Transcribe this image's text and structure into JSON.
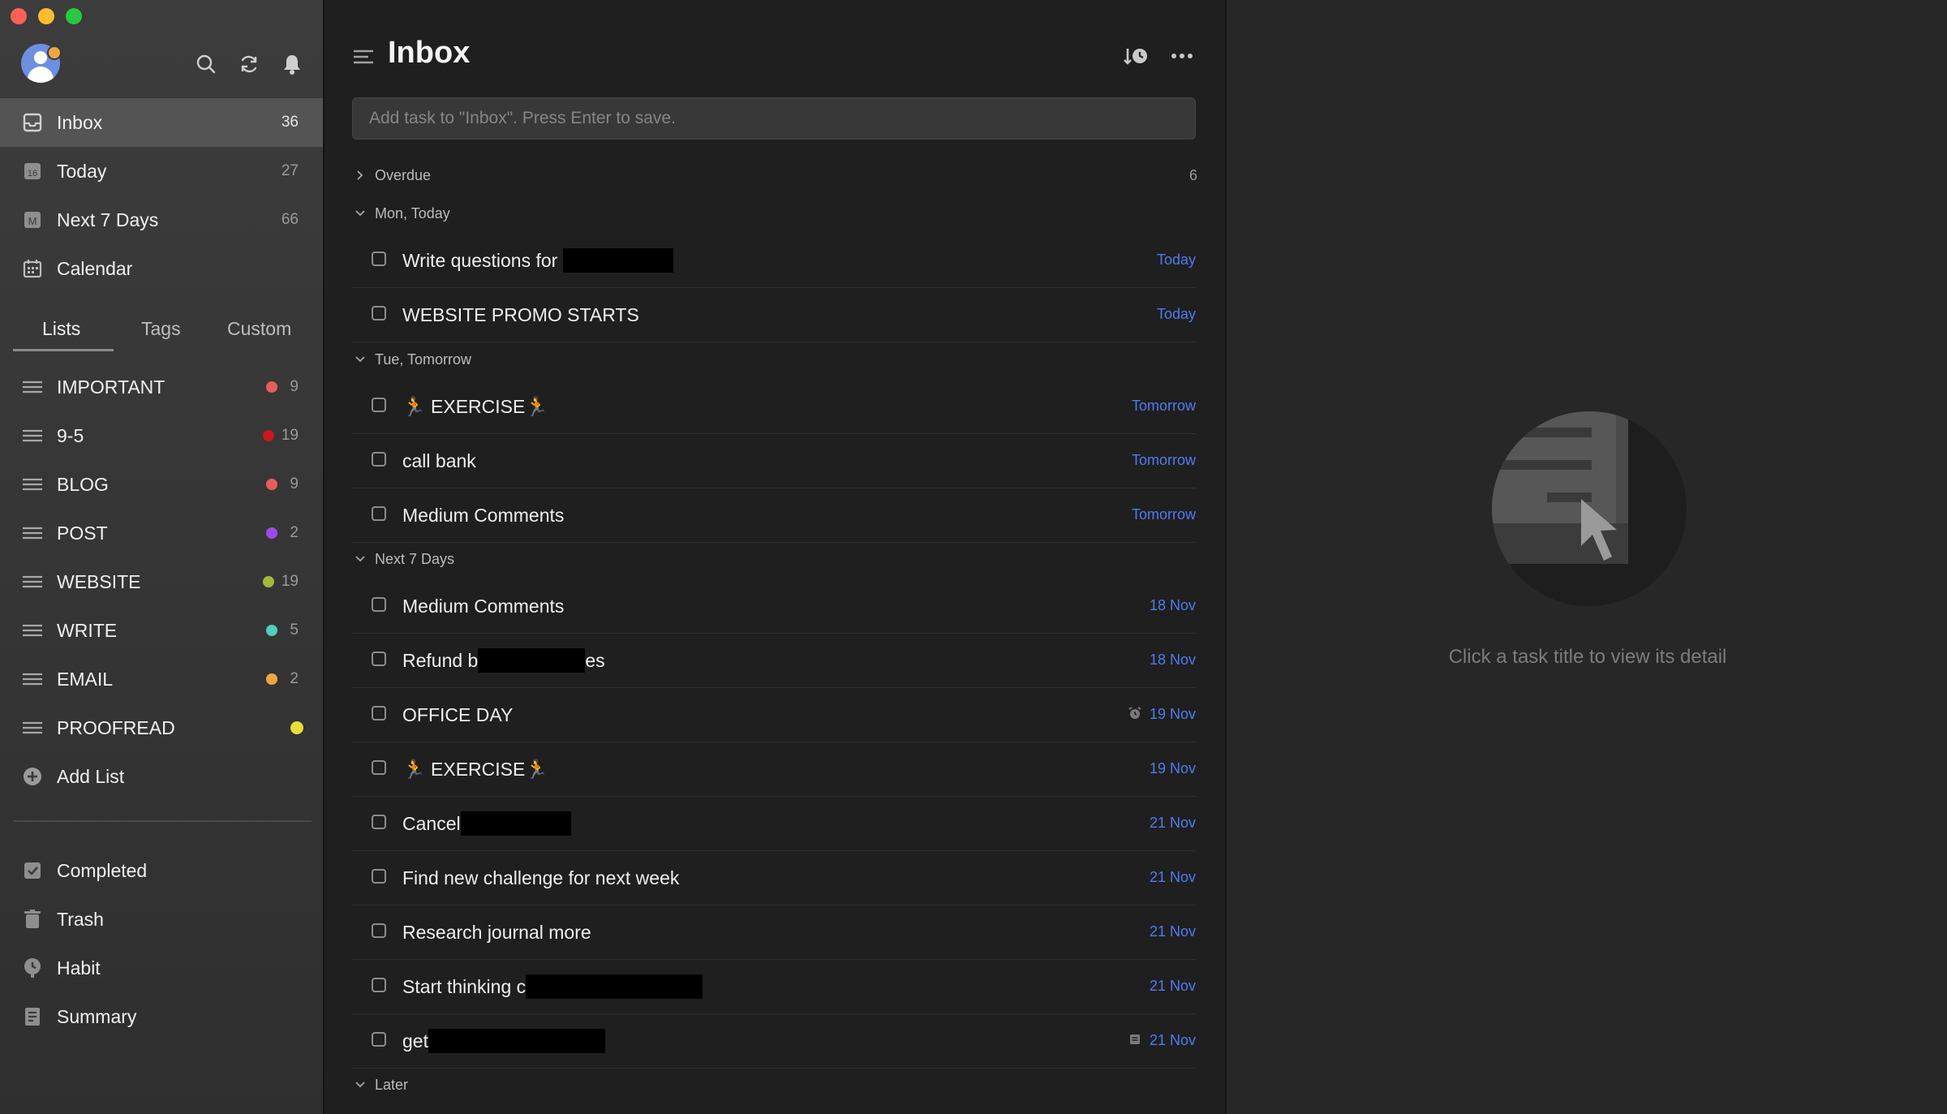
{
  "sidebar": {
    "smart_lists": [
      {
        "label": "Inbox",
        "count": "36",
        "icon": "inbox-icon"
      },
      {
        "label": "Today",
        "count": "27",
        "icon": "calendar-day-icon",
        "icon_text": "16"
      },
      {
        "label": "Next 7 Days",
        "count": "66",
        "icon": "calendar-week-icon",
        "icon_text": "M"
      },
      {
        "label": "Calendar",
        "count": "",
        "icon": "calendar-icon"
      }
    ],
    "tabs": [
      "Lists",
      "Tags",
      "Custom"
    ],
    "lists": [
      {
        "label": "IMPORTANT",
        "count": "9",
        "color": "#e85d57"
      },
      {
        "label": "9-5",
        "count": "19",
        "color": "#c81a1a"
      },
      {
        "label": "BLOG",
        "count": "9",
        "color": "#e85d57"
      },
      {
        "label": "POST",
        "count": "2",
        "color": "#9b4be8"
      },
      {
        "label": "WEBSITE",
        "count": "19",
        "color": "#a3b83a"
      },
      {
        "label": "WRITE",
        "count": "5",
        "color": "#4fd0b8"
      },
      {
        "label": "EMAIL",
        "count": "2",
        "color": "#f0a640"
      },
      {
        "label": "PROOFREAD",
        "count": "",
        "color": "#e8dd3a"
      }
    ],
    "add_list_label": "Add List",
    "bottom": [
      {
        "label": "Completed",
        "icon": "checkbox-icon"
      },
      {
        "label": "Trash",
        "icon": "trash-icon"
      },
      {
        "label": "Habit",
        "icon": "habit-icon"
      },
      {
        "label": "Summary",
        "icon": "summary-icon"
      }
    ]
  },
  "main": {
    "title": "Inbox",
    "add_task_placeholder": "Add task to \"Inbox\". Press Enter to save.",
    "sections": [
      {
        "label": "Overdue",
        "count": "6",
        "expanded": false
      },
      {
        "label": "Mon, Today",
        "expanded": true
      },
      {
        "label": "Tue, Tomorrow",
        "expanded": true
      },
      {
        "label": "Next 7 Days",
        "expanded": true
      },
      {
        "label": "Later",
        "expanded": true
      }
    ],
    "tasks": [
      {
        "pre": "Write questions for ",
        "post": "",
        "date": "Today"
      },
      {
        "pre": "WEBSITE PROMO STARTS",
        "post": "",
        "date": "Today"
      },
      {
        "pre": "🏃 EXERCISE🏃",
        "post": "",
        "date": "Tomorrow"
      },
      {
        "pre": "call bank",
        "post": "",
        "date": "Tomorrow"
      },
      {
        "pre": "Medium Comments",
        "post": "",
        "date": "Tomorrow"
      },
      {
        "pre": "Medium Comments",
        "post": "",
        "date": "18 Nov"
      },
      {
        "pre": "Refund b",
        "post": "es",
        "date": "18 Nov"
      },
      {
        "pre": "OFFICE DAY",
        "post": "",
        "date": "19 Nov",
        "date_icon": "alarm-icon"
      },
      {
        "pre": "🏃 EXERCISE🏃",
        "post": "",
        "date": "19 Nov"
      },
      {
        "pre": "Cancel",
        "post": "",
        "date": "21 Nov"
      },
      {
        "pre": "Find new  challenge for next week",
        "post": "",
        "date": "21 Nov"
      },
      {
        "pre": "Research journal more",
        "post": "",
        "date": "21 Nov"
      },
      {
        "pre": "Start  thinking c",
        "post": "",
        "date": "21 Nov"
      },
      {
        "pre": "get",
        "post": "",
        "date": "21 Nov",
        "date_icon": "note-icon"
      }
    ]
  },
  "detail": {
    "hint": "Click a task title to view its detail"
  },
  "colors": {
    "accent_blue": "#4e7cf0",
    "sidebar_active": "#545454",
    "background": "#1f1f1f"
  }
}
